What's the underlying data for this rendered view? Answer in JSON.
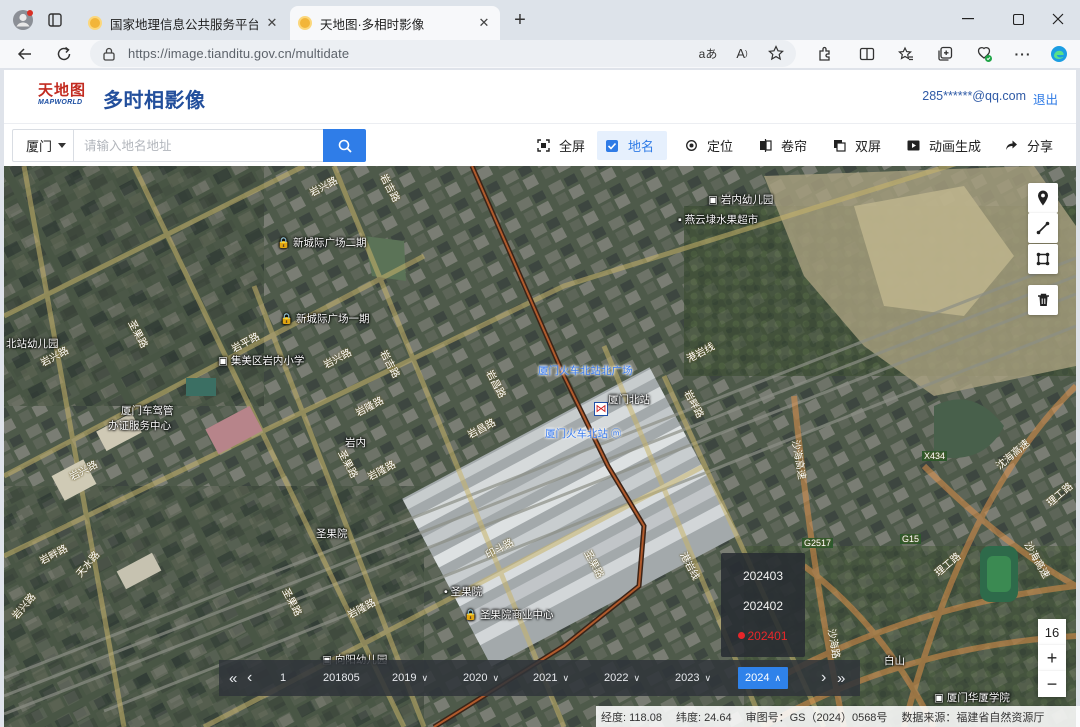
{
  "browser": {
    "tabs": [
      {
        "label": "国家地理信息公共服务平台 天地图",
        "active": false
      },
      {
        "label": "天地图·多相时影像",
        "active": true
      }
    ],
    "new_tab": "+",
    "url": "https://image.tianditu.gov.cn/multidate",
    "icons": [
      "profile-icon",
      "tab-actions-icon",
      "back-icon",
      "refresh-icon",
      "translate-icon",
      "read-aloud-icon",
      "favorite-icon",
      "extensions-icon",
      "split-screen-icon",
      "favorites-icon",
      "collections-icon",
      "copilot-icon",
      "more-icon",
      "edge-icon"
    ]
  },
  "header": {
    "logo_text": "天地图",
    "logo_subtext": "MAPWORLD",
    "title": "多时相影像",
    "user": "285******@qq.com",
    "logout": "退出"
  },
  "toolbar": {
    "city": "厦门",
    "search_placeholder": "请输入地名地址",
    "tools": [
      {
        "label": "全屏",
        "icon": "fullscreen-icon"
      },
      {
        "label": "地名",
        "icon": "checkbox-icon",
        "active": true
      },
      {
        "label": "定位",
        "icon": "locate-icon"
      },
      {
        "label": "卷帘",
        "icon": "swipe-icon"
      },
      {
        "label": "双屏",
        "icon": "dual-screen-icon"
      },
      {
        "label": "动画生成",
        "icon": "animation-icon"
      },
      {
        "label": "分享",
        "icon": "share-icon"
      }
    ]
  },
  "map": {
    "pois": {
      "yannei_kindergarten": "岩内幼儿园",
      "yanyundi_fruit": "燕云埭水果超市",
      "xinchengji_2": "新城际广场二期",
      "xinchengji_1": "新城际广场一期",
      "beizhan_kindergarten": "北站幼儿园",
      "jimei_school": "集美区岩内小学",
      "xiamen_vehicle_office_1": "厦门车驾管",
      "xiamen_vehicle_office_2": "办证服务中心",
      "north_station_square": "厦门火车北站北广场",
      "xiamen_north": "厦门北站",
      "north_station": "厦门火车北站",
      "yanneng": "岩内",
      "shengguoyuan_1": "圣果院",
      "shengguoyuan_2": "圣果院",
      "shengguoyuan_center": "圣果院商业中心",
      "xiangyang_kindergarten": "向阳幼儿园",
      "huaxia_college": "厦门华厦学院",
      "baishan": "白山"
    },
    "roads": {
      "r1": "岩兴路",
      "r2": "岩兴路",
      "r3": "岩平路",
      "r4": "岩兴路",
      "r5": "岩吉路",
      "r6": "岩隆路",
      "r7": "岩昌路",
      "r8": "岩昌路",
      "r9": "岩畔路",
      "r10": "岩隆路",
      "r11": "圣果路",
      "r12": "岩兴路",
      "r13": "港岩线",
      "r14": "沙海高速",
      "r15": "沈海高速",
      "r16": "G2517",
      "r17": "X434",
      "r18": "G15",
      "r19": "理工路",
      "r20": "印斗路",
      "r21": "圣果路",
      "r22": "天水路",
      "r23": "圣果路",
      "r24": "岩隆路",
      "r25": "岩畔路",
      "r26": "沙海路",
      "r27": "岩兴路",
      "r28": "岩吉路",
      "r29": "港岩线",
      "r30": "圣果路",
      "r31": "理工路",
      "r32": "沙海高速"
    },
    "controls": [
      "marker-icon",
      "measure-line-icon",
      "measure-area-icon",
      "delete-icon"
    ],
    "zoom_level": "16",
    "zoom_in": "+",
    "zoom_out": "−"
  },
  "timeline": {
    "first_label": "«",
    "prev_label": "‹",
    "index": "1",
    "items": [
      {
        "label": "201805",
        "chevron": false
      },
      {
        "label": "2019",
        "chevron": true
      },
      {
        "label": "2020",
        "chevron": true
      },
      {
        "label": "2021",
        "chevron": true
      },
      {
        "label": "2022",
        "chevron": true
      },
      {
        "label": "2023",
        "chevron": true
      },
      {
        "label": "2024",
        "chevron": true,
        "selected": true
      }
    ],
    "next_label": "›",
    "last_label": "»",
    "dates": [
      {
        "label": "202403"
      },
      {
        "label": "202402"
      },
      {
        "label": "202401",
        "selected": true
      }
    ]
  },
  "status": {
    "lon": "经度: 118.08",
    "lat": "纬度: 24.64",
    "approval": "审图号：GS（2024）0568号",
    "source": "数据来源：福建省自然资源厅"
  }
}
